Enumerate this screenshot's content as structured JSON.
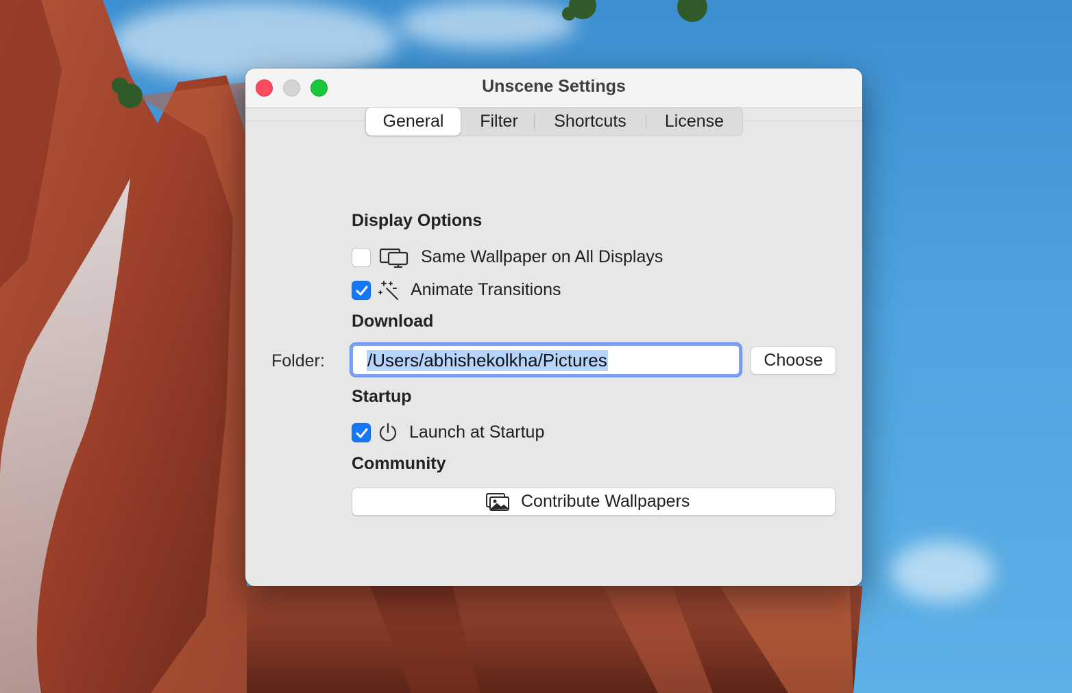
{
  "window": {
    "title": "Unscene Settings"
  },
  "tabs": [
    {
      "label": "General",
      "active": true
    },
    {
      "label": "Filter",
      "active": false
    },
    {
      "label": "Shortcuts",
      "active": false
    },
    {
      "label": "License",
      "active": false
    }
  ],
  "display_options": {
    "heading": "Display Options",
    "same_wallpaper": {
      "label": "Same Wallpaper on All Displays",
      "checked": false,
      "icon": "displays-icon"
    },
    "animate_transitions": {
      "label": "Animate Transitions",
      "checked": true,
      "icon": "sparkles-wand-icon"
    }
  },
  "download": {
    "heading": "Download",
    "folder_label": "Folder:",
    "folder_value": "/Users/abhishekolkha/Pictures",
    "choose_label": "Choose"
  },
  "startup": {
    "heading": "Startup",
    "launch_at_startup": {
      "label": "Launch at Startup",
      "checked": true,
      "icon": "power-icon"
    }
  },
  "community": {
    "heading": "Community",
    "contribute_label": "Contribute Wallpapers",
    "contribute_icon": "photos-icon"
  },
  "colors": {
    "accent": "#1479f6",
    "close": "#fe4b5e",
    "maximize": "#1ec63e",
    "focus_ring": "#7f9ff0",
    "selection": "#b5d4fc"
  }
}
